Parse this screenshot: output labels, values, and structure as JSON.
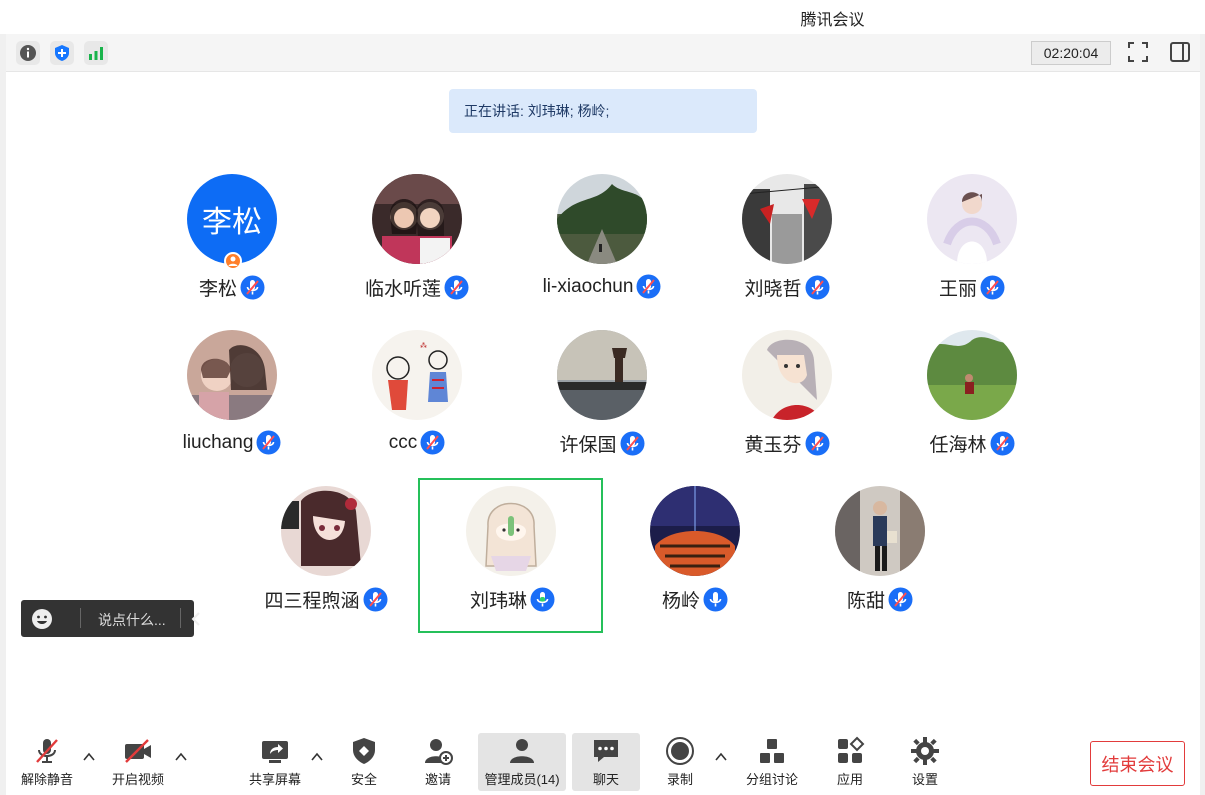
{
  "app": {
    "title": "腾讯会议"
  },
  "top_toolbar": {
    "timer": "02:20:04"
  },
  "speaking": {
    "text": "正在讲话: 刘玮琳; 杨岭;"
  },
  "participants": [
    {
      "name": "李松",
      "avatar_text": "李松"
    },
    {
      "name": "临水听莲"
    },
    {
      "name": "li-xiaochun"
    },
    {
      "name": "刘晓哲"
    },
    {
      "name": "王丽"
    },
    {
      "name": "liuchang"
    },
    {
      "name": "ccc"
    },
    {
      "name": "许保国"
    },
    {
      "name": "黄玉芬"
    },
    {
      "name": "任海林"
    },
    {
      "name": "四三程煦涵"
    },
    {
      "name": "刘玮琳"
    },
    {
      "name": "杨岭"
    },
    {
      "name": "陈甜"
    }
  ],
  "chat": {
    "placeholder": "说点什么..."
  },
  "bottom_bar": {
    "unmute": "解除静音",
    "video": "开启视频",
    "share": "共享屏幕",
    "security": "安全",
    "invite": "邀请",
    "members": "管理成员(14)",
    "chat": "聊天",
    "record": "录制",
    "breakout": "分组讨论",
    "apps": "应用",
    "settings": "设置",
    "end": "结束会议"
  },
  "colors": {
    "accent": "#0d6cf5",
    "speaking_border": "#25c05a",
    "end_red": "#e23b3b"
  }
}
